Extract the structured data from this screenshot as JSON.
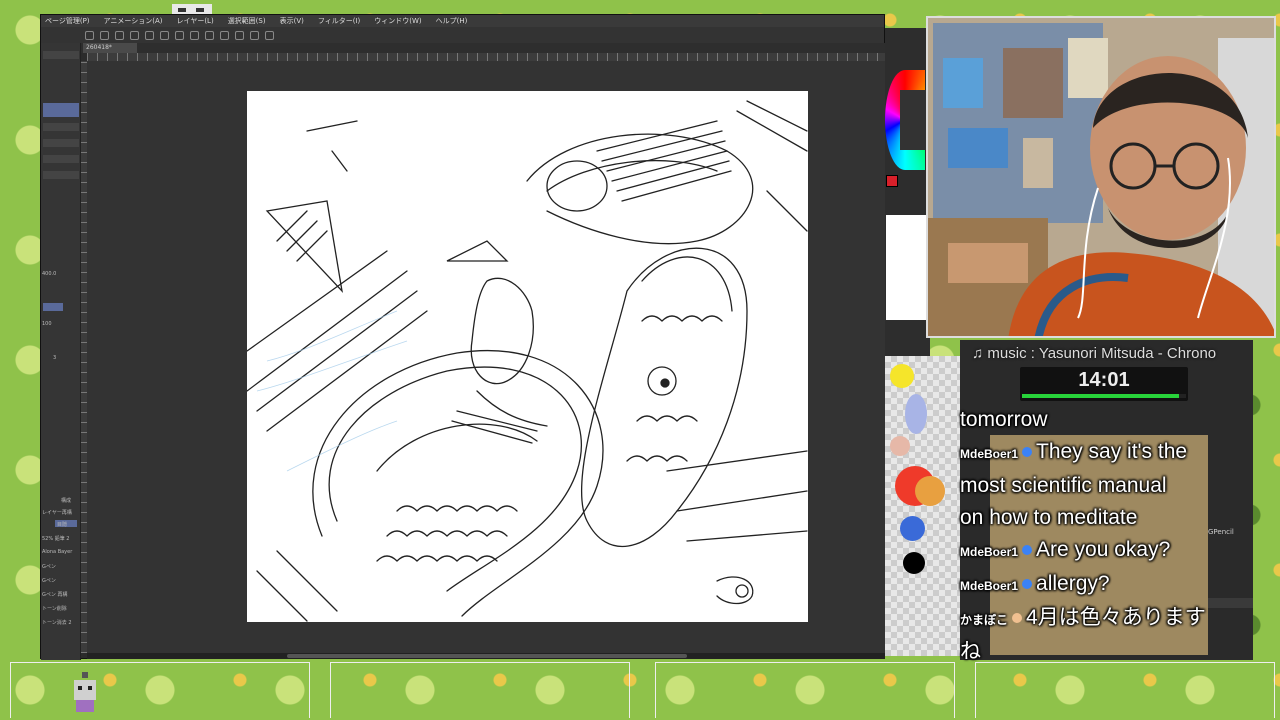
{
  "app": {
    "menu": [
      "ページ管理(P)",
      "アニメーション(A)",
      "レイヤー(L)",
      "選択範囲(S)",
      "表示(V)",
      "フィルター(I)",
      "ウィンドウ(W)",
      "ヘルプ(H)"
    ],
    "document_tab": "260418*",
    "left_panel": {
      "brush_size": "400.0",
      "opacity": "100",
      "density": "3",
      "tool_labels": [
        "構成",
        "レイヤー再構",
        "目隠",
        "52% 鉛筆 2",
        "Alona Bayer",
        "Gペン",
        "Gペン",
        "Gペン 再構",
        "トーン削除",
        "トーン消去 2"
      ]
    },
    "right_panel": {
      "color_label": "カラー",
      "foreground_color": "#d8202a",
      "brush_name": "GPencil"
    }
  },
  "stream": {
    "music": "♫ music : Yasunori Mitsuda - Chrono",
    "timer": "14:01",
    "timer_progress": 0.96,
    "chat": [
      {
        "user": "",
        "message": "tomorrow"
      },
      {
        "user": "MdeBoer1",
        "message": "They say it's the"
      },
      {
        "user": "",
        "message": "most scientific manual"
      },
      {
        "user": "",
        "message": "on how to meditate"
      },
      {
        "user": "MdeBoer1",
        "message": "Are you okay?"
      },
      {
        "user": "MdeBoer1",
        "message": "allergy?"
      },
      {
        "user": "かまぼこ",
        "message": "4月は色々あります"
      },
      {
        "user": "",
        "message": "ね"
      }
    ]
  }
}
